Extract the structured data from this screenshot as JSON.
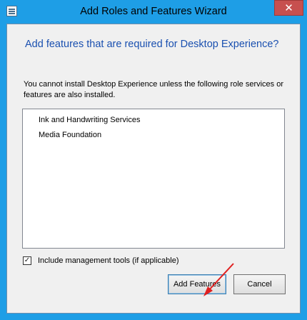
{
  "window": {
    "title": "Add Roles and Features Wizard",
    "close_glyph": "✕"
  },
  "dialog": {
    "heading": "Add features that are required for Desktop Experience?",
    "message": "You cannot install Desktop Experience unless the following role services or features are also installed.",
    "items": [
      "Ink and Handwriting Services",
      "Media Foundation"
    ],
    "include_tools": {
      "label": "Include management tools (if applicable)",
      "checked": true,
      "check_glyph": "✓"
    },
    "buttons": {
      "add_label": "Add Features",
      "cancel_label": "Cancel"
    }
  },
  "colors": {
    "title_bar": "#1e9ee6",
    "heading_text": "#1a50b0",
    "close_button": "#c7504f",
    "annotation_arrow": "#e02020"
  },
  "icons": {
    "app": "server-manager-icon",
    "close": "close-icon",
    "annotation": "red-arrow-icon"
  }
}
